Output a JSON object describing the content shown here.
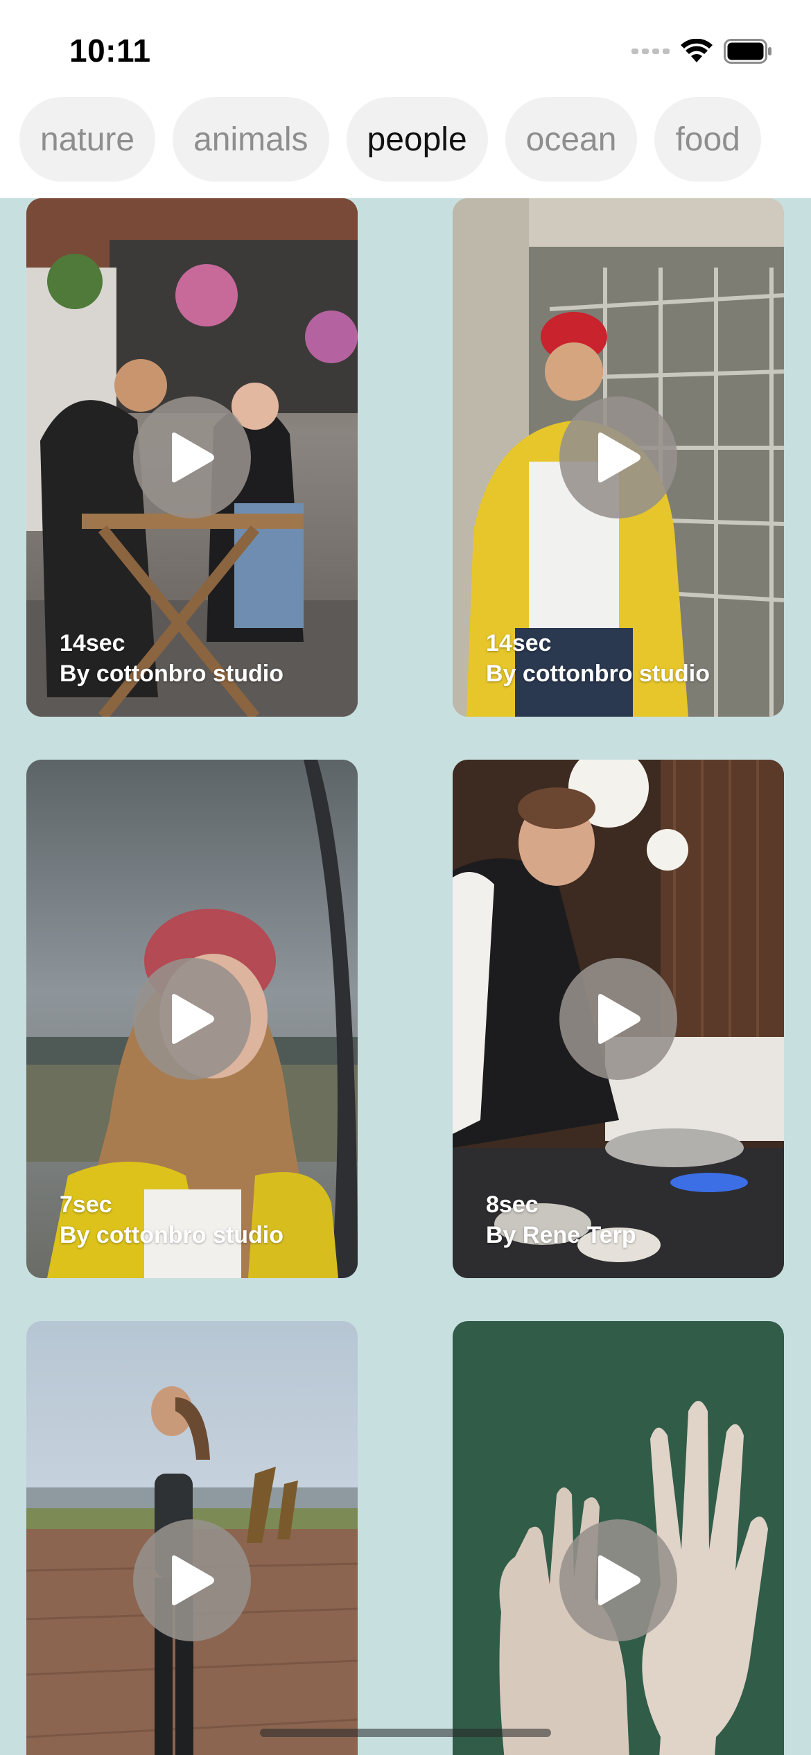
{
  "status_bar": {
    "time": "10:11"
  },
  "tabs": [
    {
      "label": "nature"
    },
    {
      "label": "animals"
    },
    {
      "label": "people",
      "active": true
    },
    {
      "label": "ocean"
    },
    {
      "label": "food"
    }
  ],
  "videos": [
    {
      "duration": "14sec",
      "author": "By cottonbro studio"
    },
    {
      "duration": "14sec",
      "author": "By cottonbro studio"
    },
    {
      "duration": "7sec",
      "author": "By cottonbro studio"
    },
    {
      "duration": "8sec",
      "author": "By Rene Terp"
    },
    {
      "duration": "",
      "author": ""
    },
    {
      "duration": "",
      "author": ""
    }
  ],
  "colors": {
    "background": "#c8dfdf",
    "tab_background": "#f1f1f1",
    "tab_text": "#8e8e8e",
    "tab_text_active": "#111111",
    "play_button": "#96918c"
  }
}
